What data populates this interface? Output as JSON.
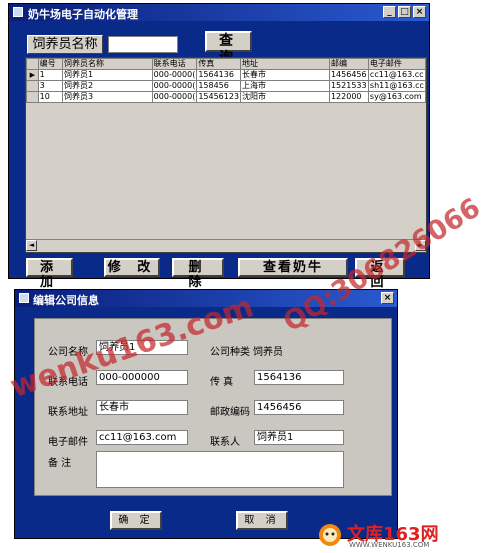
{
  "main_window": {
    "title": "奶牛场电子自动化管理",
    "title_buttons": [
      "_",
      "□",
      "×"
    ],
    "search_label": "饲养员名称",
    "search_input_value": "",
    "query_button": "查 询",
    "grid": {
      "columns": [
        "编号",
        "饲养员名称",
        "联系电话",
        "传真",
        "地址",
        "邮编",
        "电子邮件"
      ],
      "rows": [
        [
          "1",
          "饲养员1",
          "000-0000(",
          "1564136",
          "长春市",
          "1456456",
          "cc11@163.cc"
        ],
        [
          "3",
          "饲养员2",
          "000-0000(",
          "158456",
          "上海市",
          "1521533",
          "sh11@163.cc"
        ],
        [
          "10",
          "饲养员3",
          "000-0000(",
          "15456123",
          "沈阳市",
          "122000",
          "sy@163.com"
        ]
      ],
      "selected_row_marker": "▶",
      "scroll_left": "◄",
      "scroll_right": "►"
    },
    "buttons": {
      "add": "添 加",
      "edit": "修 改",
      "delete": "删 除",
      "view_cows": "查看奶牛",
      "back": "返 回"
    }
  },
  "dialog": {
    "title": "编辑公司信息",
    "close": "×",
    "fields": {
      "company_name_label": "公司名称",
      "company_name_value": "饲养员1",
      "company_type_label": "公司种类",
      "company_type_value": "饲养员",
      "phone_label": "联系电话",
      "phone_value": "000-000000",
      "fax_label": "传  真",
      "fax_value": "1564136",
      "address_label": "联系地址",
      "address_value": "长春市",
      "postcode_label": "邮政编码",
      "postcode_value": "1456456",
      "email_label": "电子邮件",
      "email_value": "cc11@163.com",
      "contact_label": "联系人",
      "contact_value": "饲养员1",
      "remark_label": "备  注",
      "remark_value": ""
    },
    "ok_button": "确 定",
    "cancel_button": "取 消"
  },
  "watermarks": {
    "site": "wenku163.com",
    "qq": "QQ:306826066"
  },
  "logo": {
    "brand": "文库163网",
    "url": "WWW.WENKU163.COM"
  },
  "colors": {
    "window_bg": "#0a2a8a",
    "titlebar": "#0a1e7a",
    "watermark_red": "#c4282e",
    "logo_red": "#e02020",
    "logo_orange": "#f08a10"
  }
}
